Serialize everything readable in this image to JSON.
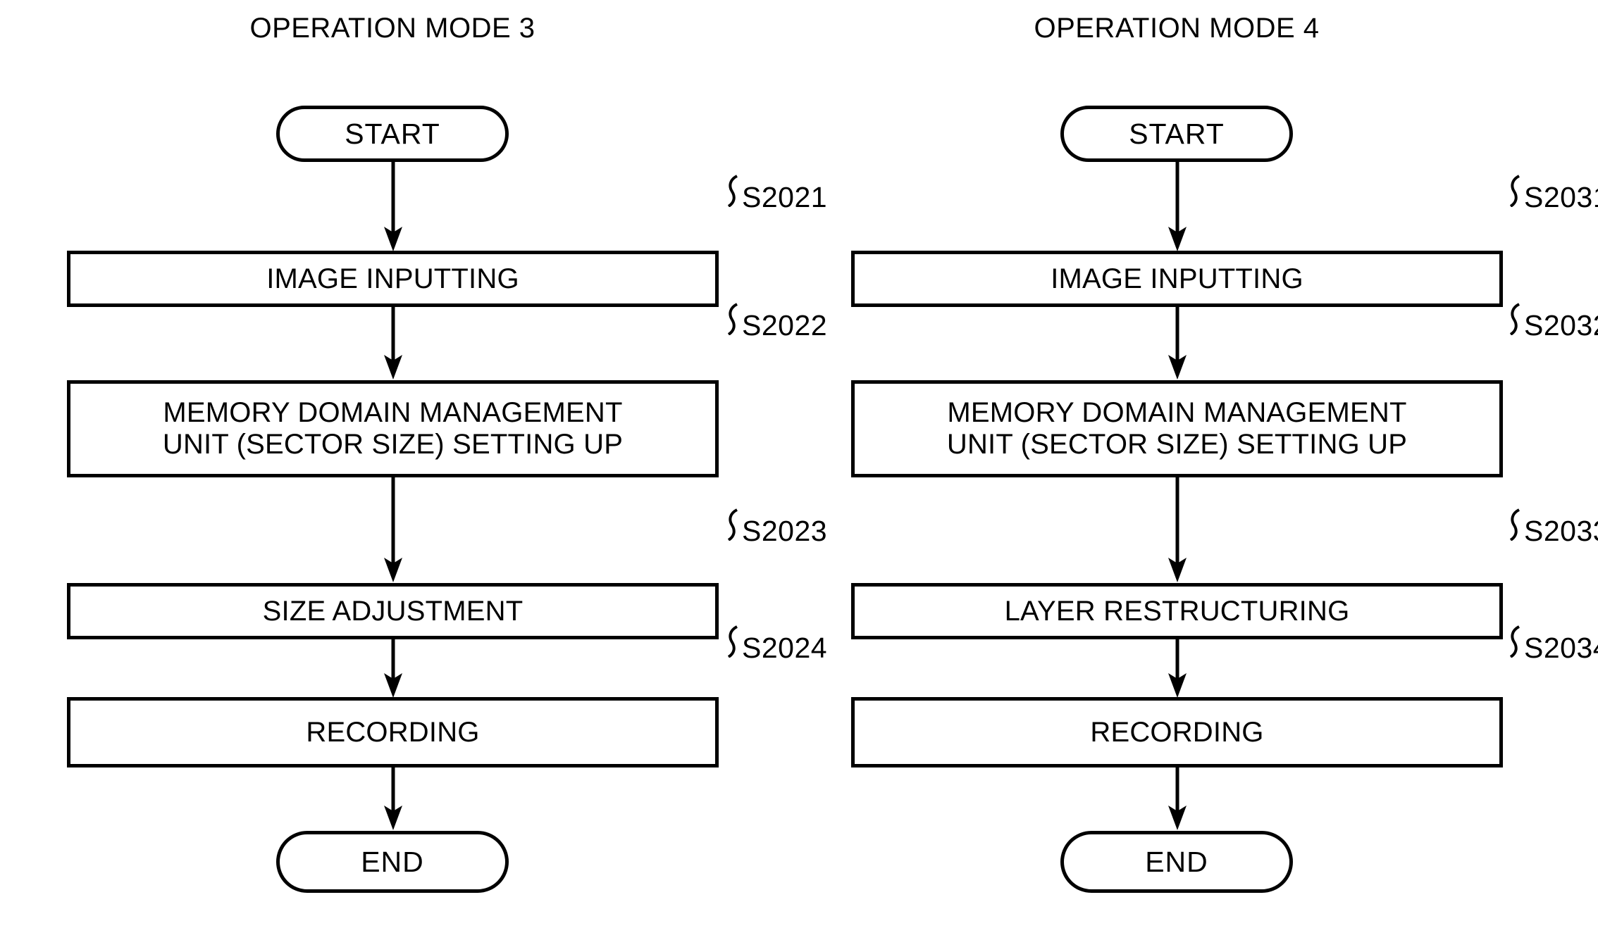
{
  "figure": {
    "type": "flowchart",
    "columns": [
      {
        "id": "mode3",
        "title": "OPERATION MODE 3",
        "start_label": "START",
        "end_label": "END",
        "steps": [
          {
            "id": "S2021",
            "text": "IMAGE INPUTTING",
            "text_line2": ""
          },
          {
            "id": "S2022",
            "text": "MEMORY DOMAIN MANAGEMENT",
            "text_line2": "UNIT (SECTOR SIZE) SETTING UP"
          },
          {
            "id": "S2023",
            "text": "SIZE ADJUSTMENT",
            "text_line2": ""
          },
          {
            "id": "S2024",
            "text": "RECORDING",
            "text_line2": ""
          }
        ]
      },
      {
        "id": "mode4",
        "title": "OPERATION MODE 4",
        "start_label": "START",
        "end_label": "END",
        "steps": [
          {
            "id": "S2031",
            "text": "IMAGE INPUTTING",
            "text_line2": ""
          },
          {
            "id": "S2032",
            "text": "MEMORY DOMAIN MANAGEMENT",
            "text_line2": "UNIT (SECTOR SIZE) SETTING UP"
          },
          {
            "id": "S2033",
            "text": "LAYER RESTRUCTURING",
            "text_line2": ""
          },
          {
            "id": "S2034",
            "text": "RECORDING",
            "text_line2": ""
          }
        ]
      }
    ],
    "colors": {
      "stroke": "#000000",
      "fill": "#ffffff",
      "text": "#000000"
    },
    "icons": {
      "arrowhead": "arrow-down-icon",
      "leader": "squiggle-leader-icon"
    }
  }
}
